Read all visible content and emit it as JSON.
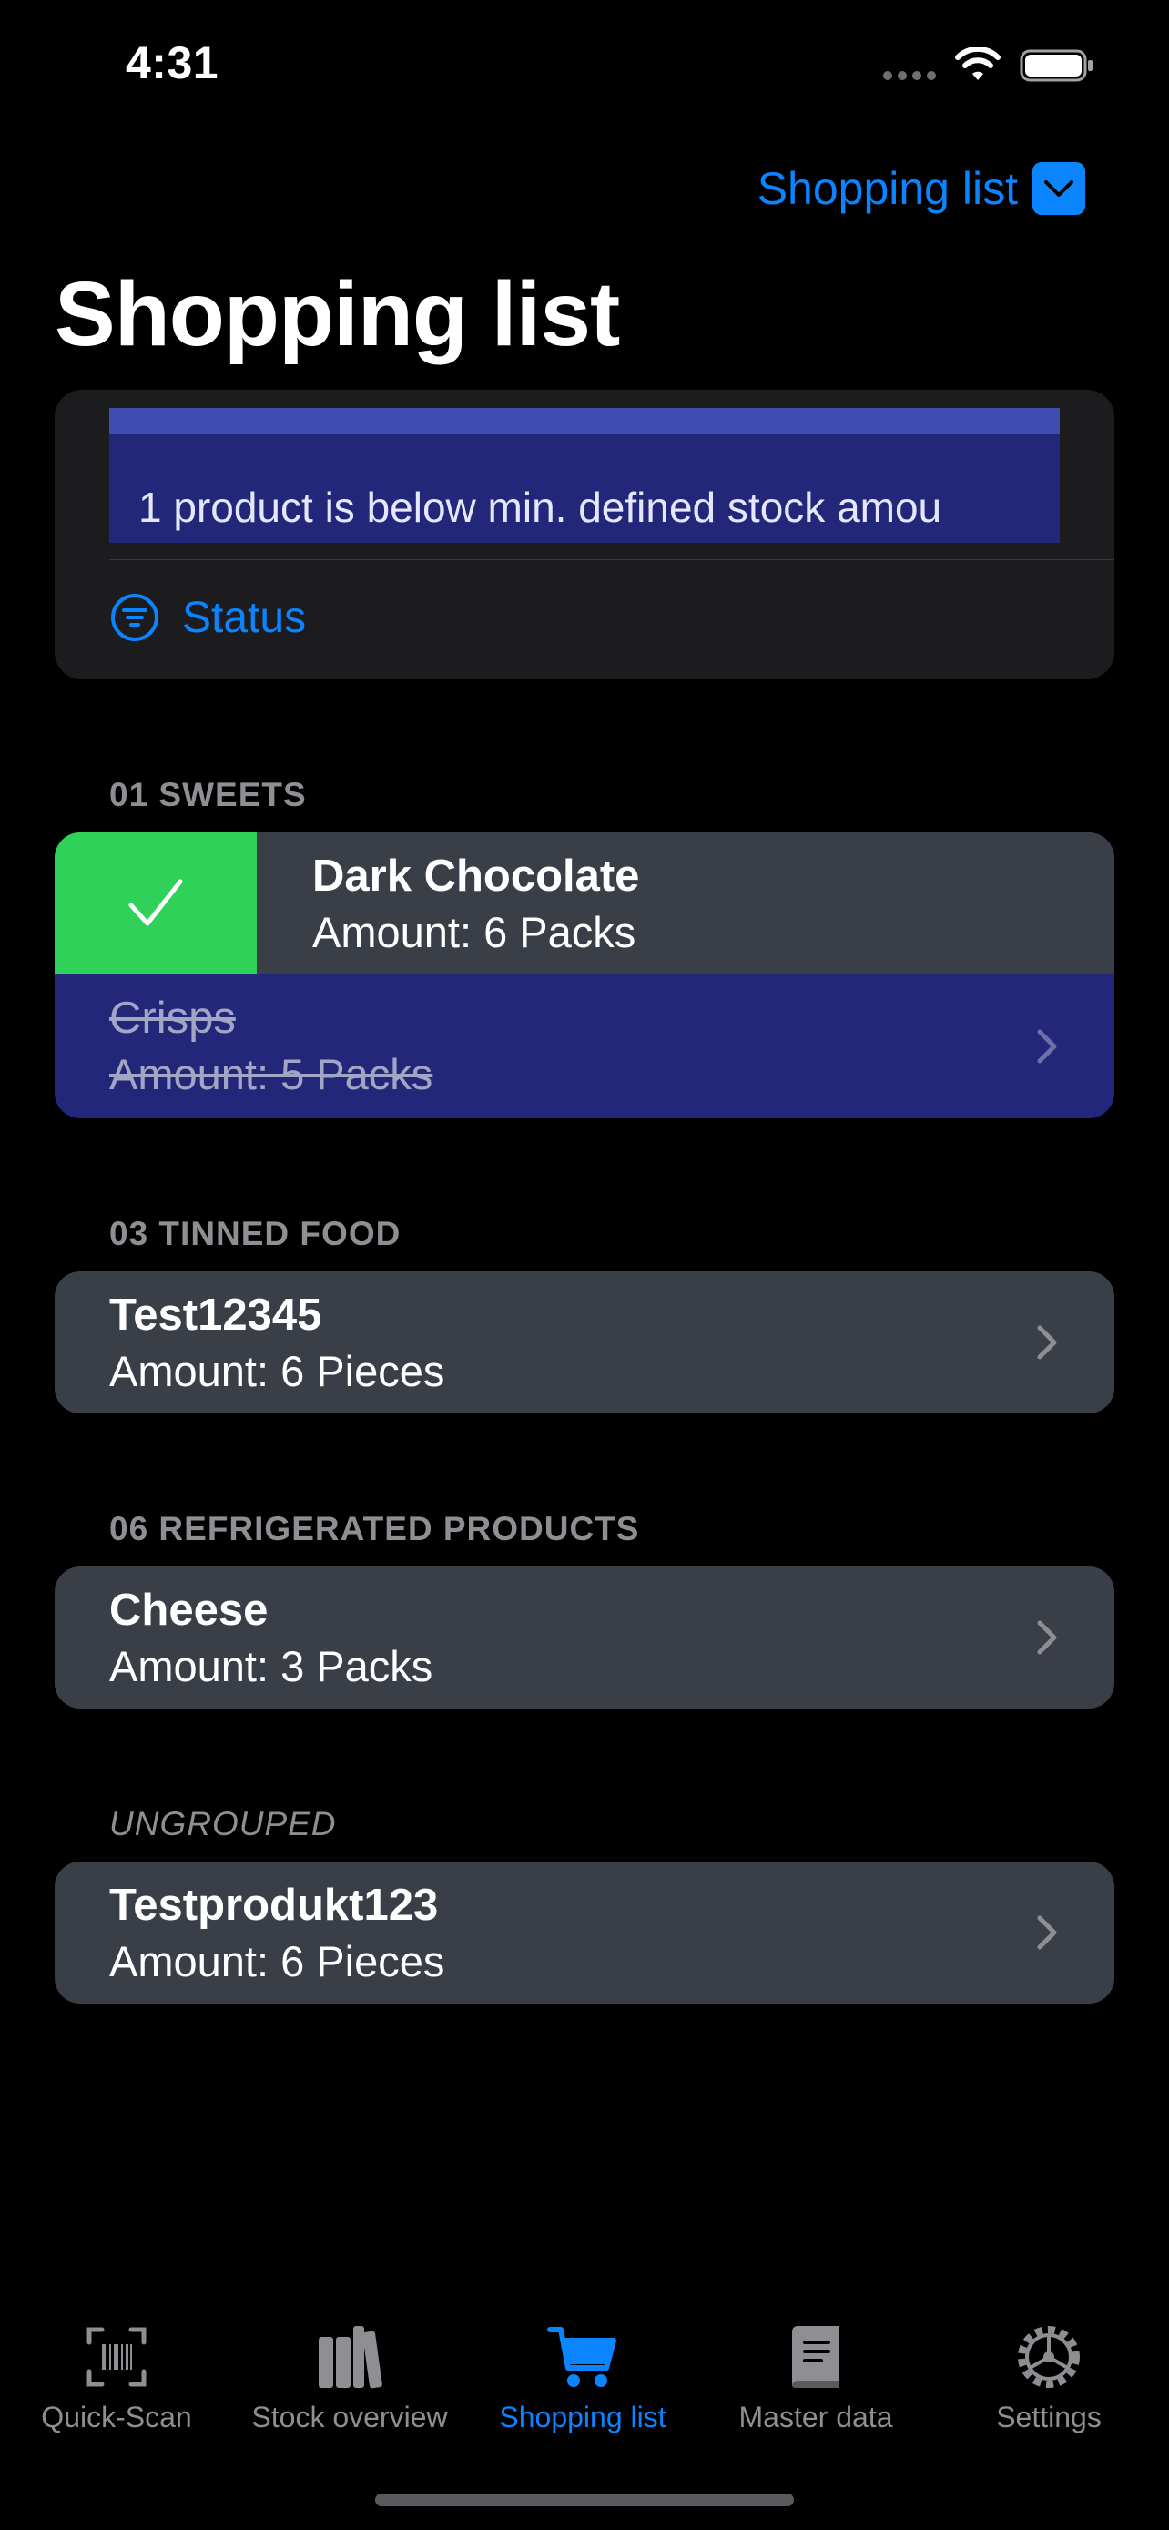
{
  "status_bar": {
    "time": "4:31"
  },
  "nav": {
    "picker_label": "Shopping list",
    "title": "Shopping list"
  },
  "top_card": {
    "banner_text": "1 product is below min. defined stock amou",
    "status_label": "Status"
  },
  "groups": [
    {
      "header": "01 SWEETS",
      "items": [
        {
          "name": "Dark Chocolate",
          "amount": "Amount: 6 Packs",
          "state": "swiped-done"
        },
        {
          "name": "Crisps",
          "amount": "Amount: 5 Packs",
          "state": "done"
        }
      ]
    },
    {
      "header": "03 TINNED FOOD",
      "items": [
        {
          "name": "Test12345",
          "amount": "Amount: 6 Pieces"
        }
      ]
    },
    {
      "header": "06 REFRIGERATED PRODUCTS",
      "items": [
        {
          "name": "Cheese",
          "amount": "Amount: 3 Packs"
        }
      ]
    },
    {
      "header": "UNGROUPED",
      "items": [
        {
          "name": "Testprodukt123",
          "amount": "Amount: 6 Pieces"
        }
      ]
    }
  ],
  "tabbar": {
    "tabs": [
      {
        "label": "Quick-Scan",
        "icon": "barcode-scan-icon"
      },
      {
        "label": "Stock overview",
        "icon": "books-icon"
      },
      {
        "label": "Shopping list",
        "icon": "cart-icon",
        "active": true
      },
      {
        "label": "Master data",
        "icon": "book-icon"
      },
      {
        "label": "Settings",
        "icon": "gear-icon"
      }
    ]
  },
  "colors": {
    "accent": "#0a84ff",
    "done_green": "#30d158",
    "done_row": "#23277a",
    "row_bg": "#3a3f47"
  }
}
